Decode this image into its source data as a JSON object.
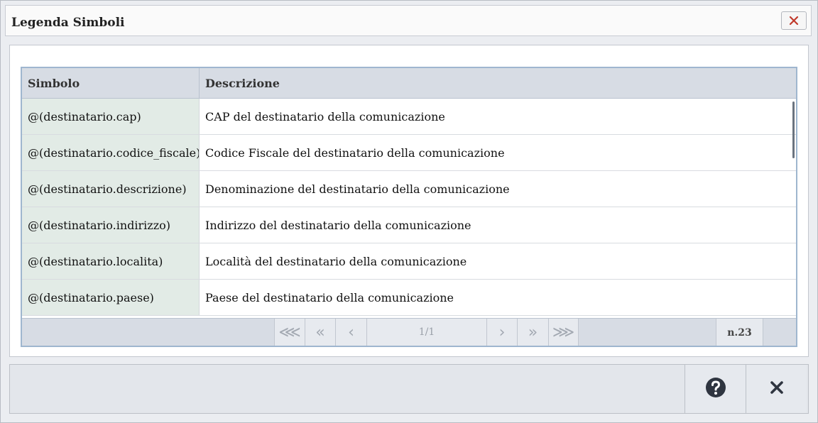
{
  "dialog": {
    "title": "Legenda Simboli"
  },
  "table": {
    "columns": [
      "Simbolo",
      "Descrizione"
    ],
    "rows": [
      {
        "symbol": "@(destinatario.cap)",
        "description": "CAP del destinatario della comunicazione"
      },
      {
        "symbol": "@(destinatario.codice_fiscale)",
        "description": "Codice Fiscale del destinatario della comunicazione"
      },
      {
        "symbol": "@(destinatario.descrizione)",
        "description": "Denominazione del destinatario della comunicazione"
      },
      {
        "symbol": "@(destinatario.indirizzo)",
        "description": "Indirizzo del destinatario della comunicazione"
      },
      {
        "symbol": "@(destinatario.localita)",
        "description": "Località del destinatario della comunicazione"
      },
      {
        "symbol": "@(destinatario.paese)",
        "description": "Paese del destinatario della comunicazione"
      }
    ]
  },
  "pager": {
    "first_glyph": "⋘",
    "prev_page_glyph": "«",
    "prev_glyph": "‹",
    "page_info": "1/1",
    "next_glyph": "›",
    "next_page_glyph": "»",
    "last_glyph": "⋙",
    "count": "n.23"
  },
  "icons": {
    "title_close": "close-icon",
    "help": "help-icon",
    "footer_close": "close-icon"
  },
  "colors": {
    "close_red": "#c0392b",
    "footer_icon": "#2f3540",
    "symbol_column_bg": "#e2ebe6",
    "header_bg": "#d7dce4"
  }
}
